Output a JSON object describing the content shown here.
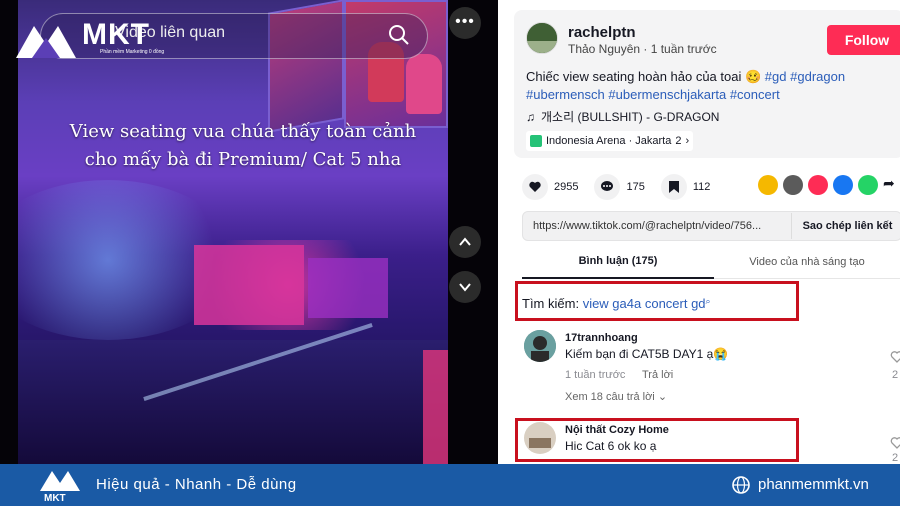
{
  "video": {
    "overlay_line1": "View seating vua chúa thấy toàn cảnh",
    "overlay_line2": "cho mấy bà đi Premium/ Cat 5 nha",
    "search_text": "Video liên quan",
    "more_label": "•••"
  },
  "logo": {
    "brand": "MKT",
    "sub": "Phần mềm Marketing 0 đồng"
  },
  "post": {
    "username": "rachelptn",
    "display_name": "Thảo Nguyên",
    "time": "1 tuần trước",
    "follow_label": "Follow",
    "description": "Chiếc view seating hoàn hảo của toai 🥴",
    "hashtags": [
      "#gd",
      "#gdragon",
      "#ubermensch",
      "#ubermenschjakarta",
      "#concert"
    ],
    "music": "개소리 (BULLSHIT) - G-DRAGON",
    "location": "Indonesia Arena · Jakarta",
    "location_count": "2"
  },
  "stats": {
    "likes": "2955",
    "comments": "175",
    "saves": "112"
  },
  "link": {
    "url": "https://www.tiktok.com/@rachelptn/video/756...",
    "copy_label": "Sao chép liên kết"
  },
  "tabs": {
    "comments": "Bình luận (175)",
    "creator_videos": "Video của nhà sáng tạo"
  },
  "search_suggestion": {
    "prefix": "Tìm kiếm:",
    "query": "view ga4a concert gd"
  },
  "comments": [
    {
      "user": "17trannhoang",
      "text": "Kiếm bạn đi CAT5B DAY1 ạ😭",
      "time": "1 tuần trước",
      "reply": "Trả lời",
      "view_replies": "Xem 18 câu trả lời",
      "likes": "2"
    },
    {
      "user": "Nội thất Cozy Home",
      "text": "Hic Cat 6 ok ko ạ",
      "likes": "2"
    }
  ],
  "banner": {
    "tagline": "Hiệu quả - Nhanh - Dễ dùng",
    "site": "phanmemmkt.vn"
  },
  "colors": {
    "follow": "#fe2c55",
    "hashtag": "#2b5db9",
    "highlight": "#c8101e",
    "banner": "#1a5aa5"
  }
}
